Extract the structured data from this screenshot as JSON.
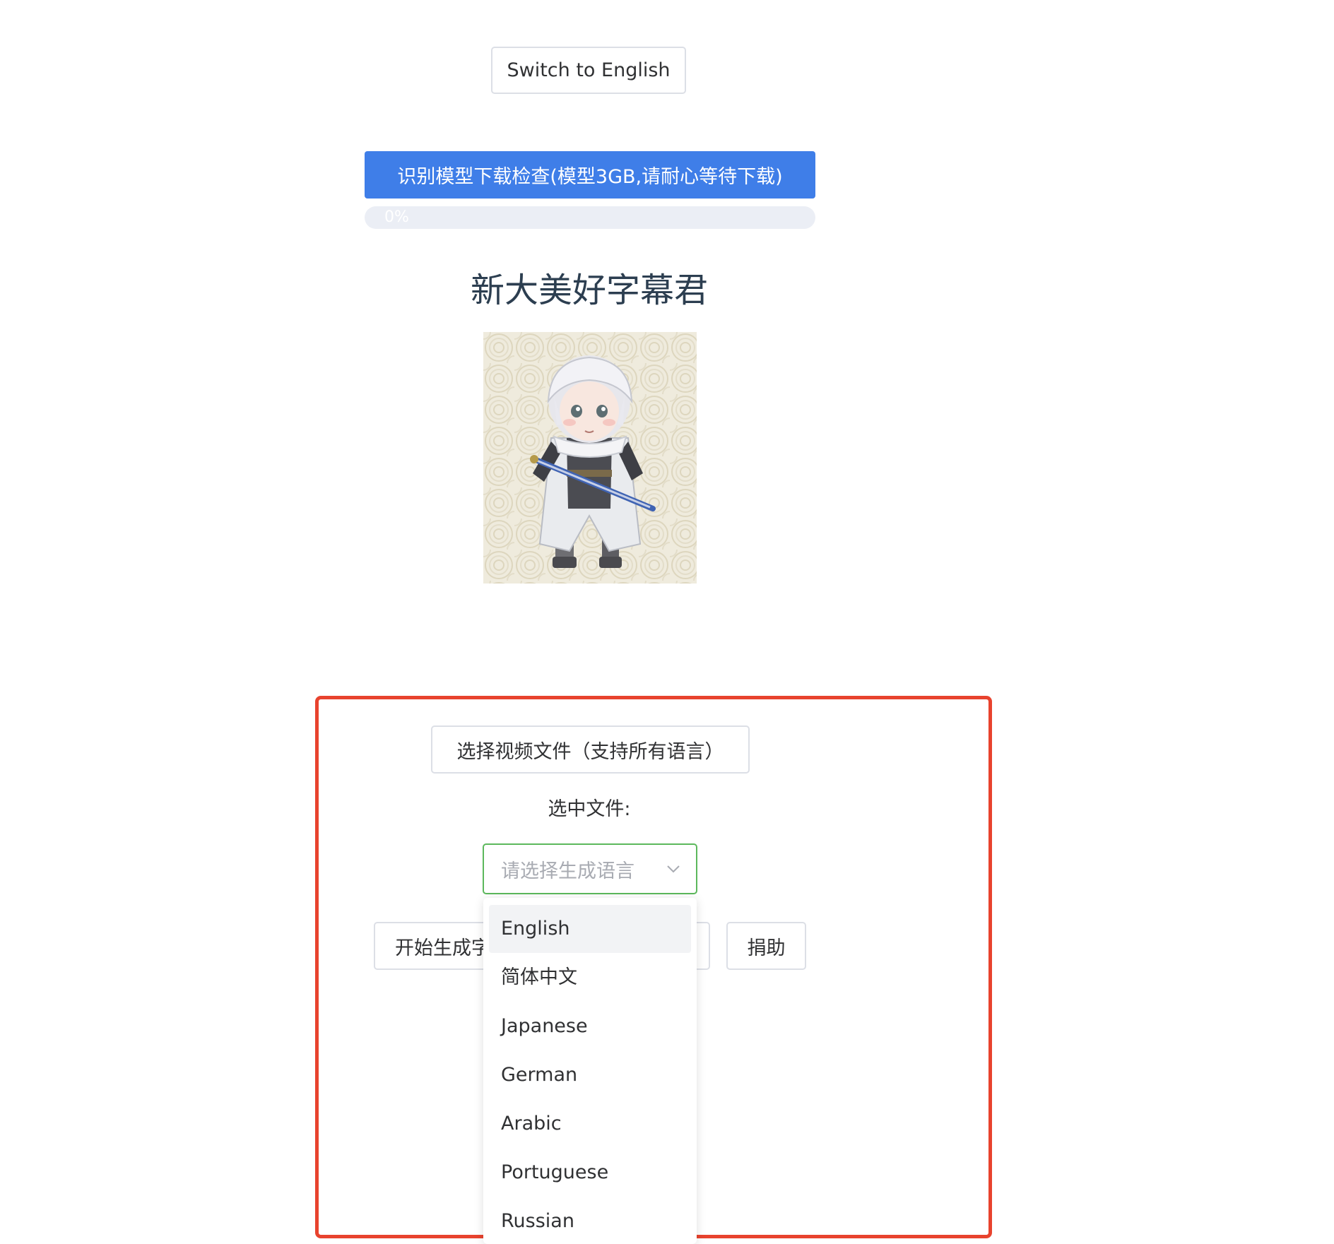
{
  "header": {
    "switch_language_label": "Switch to English",
    "model_check_label": "识别模型下载检查(模型3GB,请耐心等待下载)",
    "progress": {
      "value": 0,
      "text": "0%"
    },
    "title": "新大美好字幕君"
  },
  "mascot": {
    "icon": "swordsman-character-icon"
  },
  "panel": {
    "choose_video_label": "选择视频文件（支持所有语言）",
    "selected_file_label": "选中文件:",
    "language_select": {
      "placeholder": "请选择生成语言",
      "open": true,
      "highlighted": "English",
      "options": [
        "English",
        "简体中文",
        "Japanese",
        "German",
        "Arabic",
        "Portuguese",
        "Russian"
      ]
    },
    "start_label": "开始生成字",
    "donate_label": "捐助"
  },
  "colors": {
    "primary": "#3f7ee8",
    "highlight_frame": "#e8432e",
    "select_border": "#5cb85c",
    "title": "#2c3e50"
  }
}
